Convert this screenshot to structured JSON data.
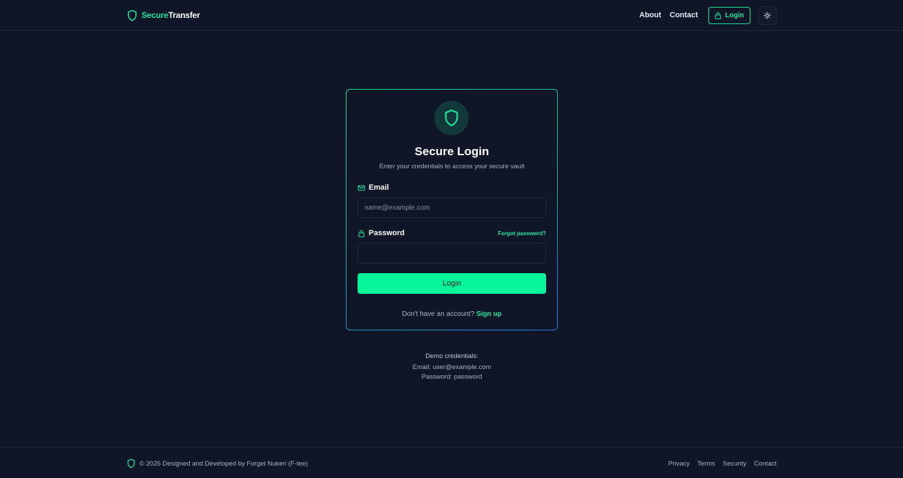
{
  "header": {
    "brand_secure": "Secure",
    "brand_transfer": "Transfer",
    "nav": {
      "about": "About",
      "contact": "Contact"
    },
    "login_label": "Login",
    "theme_icon": "sun-icon"
  },
  "card": {
    "icon": "shield-icon",
    "title": "Secure Login",
    "subtitle": "Enter your credentials to access your secure vault",
    "email_label": "Email",
    "email_placeholder": "name@example.com",
    "email_value": "",
    "password_label": "Password",
    "password_value": "",
    "forgot_label": "Forgot password?",
    "submit_label": "Login",
    "signup_prompt": "Don't have an account?",
    "signup_link": "Sign up"
  },
  "demo": {
    "title": "Demo credentials:",
    "email_line": "Email: user@example.com",
    "password_line": "Password: password"
  },
  "footer": {
    "copyright": "© 2025 Designed and Developed by Forget Nukeri (F-tee)",
    "links": [
      "Privacy",
      "Terms",
      "Security",
      "Contact"
    ]
  },
  "colors": {
    "background": "#0f1628",
    "accent": "#19e59a",
    "button": "#05f59a",
    "border_gradient_end": "#2a79e0"
  }
}
